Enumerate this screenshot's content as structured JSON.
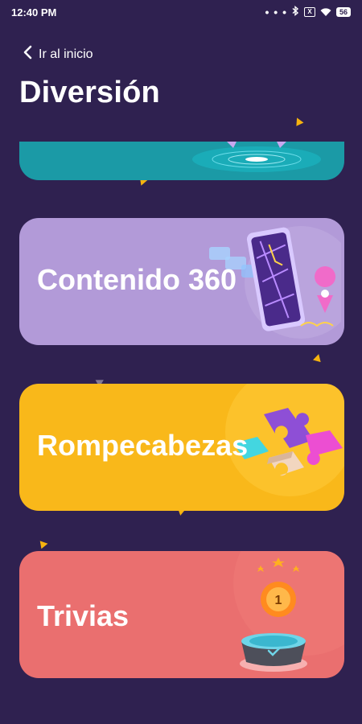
{
  "status_bar": {
    "time": "12:40 PM",
    "signal_dots": "• • •",
    "muted_label": "X",
    "battery": "56"
  },
  "header": {
    "back_label": "Ir al inicio",
    "title": "Diversión"
  },
  "cards": [
    {
      "label": ""
    },
    {
      "label": "Contenido 360"
    },
    {
      "label": "Rompecabezas"
    },
    {
      "label": "Trivias"
    }
  ],
  "trivia_medal_number": "1",
  "colors": {
    "background": "#2f2150",
    "teal_card": "#1b9aa6",
    "lavender_card": "#b29ad8",
    "yellow_card": "#f9b81a",
    "coral_card": "#ea6f6f",
    "confetti": "#f6b30f"
  },
  "icons": [
    "bluetooth-icon",
    "wifi-icon",
    "battery-icon",
    "chevron-left-icon",
    "phone-map-icon",
    "puzzle-icon",
    "medal-icon"
  ]
}
